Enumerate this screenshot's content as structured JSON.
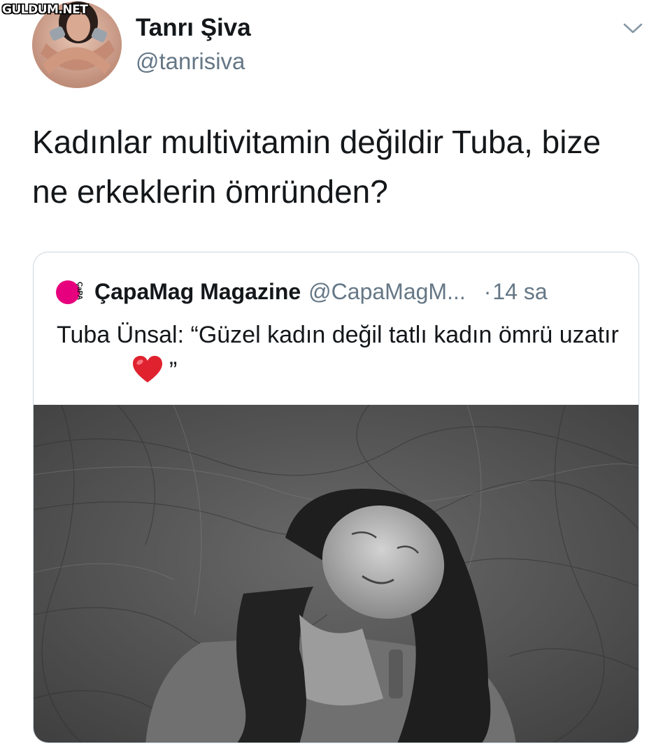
{
  "watermark": "GULDUM.NET",
  "author": {
    "display_name": "Tanrı Şiva",
    "handle": "@tanrisiva"
  },
  "tweet": {
    "text": "Kadınlar multivitamin değildir Tuba, bize ne erkeklerin ömründen?"
  },
  "quoted_tweet": {
    "logo_text": "ÇaPA",
    "display_name": "ÇapaMag Magazine",
    "handle": "@CapaMagM...",
    "separator": "·",
    "time": "14 sa",
    "text": "Tuba Ünsal: “Güzel kadın değil tatlı kadın ömrü uzatır",
    "text_end": "”",
    "media": "black-and-white photo of a smiling woman with closed eyes against a crumpled fabric backdrop"
  },
  "icons": {
    "caret": "chevron-down-icon",
    "heart": "red-heart-emoji-icon",
    "logo": "capamag-logo-icon"
  },
  "colors": {
    "text_primary": "#14171a",
    "text_secondary": "#657786",
    "border": "#ccd6dd",
    "logo_magenta": "#e6007e",
    "heart_red": "#e0222f"
  }
}
